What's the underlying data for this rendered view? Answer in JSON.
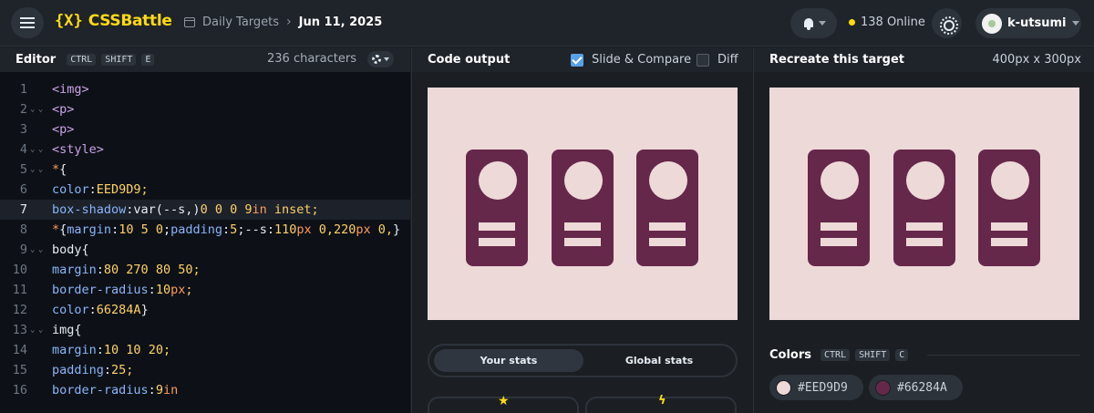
{
  "topbar": {
    "logo_mark": "{X}",
    "logo_text": "CSSBattle",
    "breadcrumb_link": "Daily Targets",
    "breadcrumb_current": "Jun 11, 2025",
    "online_count": "138 Online",
    "username": "k-utsumi"
  },
  "editor": {
    "title": "Editor",
    "shortcut": [
      "CTRL",
      "SHIFT",
      "E"
    ],
    "characters": "236 characters",
    "active_line": 7,
    "lines": [
      {
        "n": "1",
        "fold": "",
        "tokens": [
          [
            "t-tag",
            "<img>"
          ]
        ]
      },
      {
        "n": "2",
        "fold": "⌄ ⌄",
        "tokens": [
          [
            "t-tag",
            "<p>"
          ]
        ]
      },
      {
        "n": "3",
        "fold": "",
        "tokens": [
          [
            "t-tag",
            "<p>"
          ]
        ]
      },
      {
        "n": "4",
        "fold": "⌄ ⌄",
        "tokens": [
          [
            "t-tag",
            "<style>"
          ]
        ]
      },
      {
        "n": "5",
        "fold": "⌄ ⌄",
        "tokens": [
          [
            "t-sel",
            "*"
          ],
          [
            "t-plain",
            "{"
          ]
        ]
      },
      {
        "n": "6",
        "fold": "",
        "tokens": [
          [
            "t-prop",
            "color"
          ],
          [
            "t-plain",
            ":"
          ],
          [
            "t-val",
            "EED9D9;"
          ]
        ]
      },
      {
        "n": "7",
        "fold": "",
        "tokens": [
          [
            "t-prop",
            "box-shadow"
          ],
          [
            "t-plain",
            ":var(--s,)"
          ],
          [
            "t-val",
            "0 0 0 9"
          ],
          [
            "t-sel",
            "in"
          ],
          [
            "t-val",
            " inset;"
          ]
        ]
      },
      {
        "n": "8",
        "fold": "",
        "tokens": [
          [
            "t-sel",
            "*"
          ],
          [
            "t-plain",
            "{"
          ],
          [
            "t-prop",
            "margin"
          ],
          [
            "t-plain",
            ":"
          ],
          [
            "t-val",
            "10 5 0"
          ],
          [
            "t-plain",
            ";"
          ],
          [
            "t-prop",
            "padding"
          ],
          [
            "t-plain",
            ":"
          ],
          [
            "t-val",
            "5"
          ],
          [
            "t-plain",
            ";--s:"
          ],
          [
            "t-val",
            "110"
          ],
          [
            "t-sel",
            "px"
          ],
          [
            "t-val",
            " 0,220"
          ],
          [
            "t-sel",
            "px"
          ],
          [
            "t-val",
            " 0,"
          ],
          [
            "t-plain",
            "}"
          ]
        ]
      },
      {
        "n": "9",
        "fold": "⌄ ⌄",
        "tokens": [
          [
            "t-plain",
            "body{"
          ]
        ]
      },
      {
        "n": "10",
        "fold": "",
        "tokens": [
          [
            "t-prop",
            "margin"
          ],
          [
            "t-plain",
            ":"
          ],
          [
            "t-val",
            "80 270 80 50;"
          ]
        ]
      },
      {
        "n": "11",
        "fold": "",
        "tokens": [
          [
            "t-prop",
            "border-radius"
          ],
          [
            "t-plain",
            ":"
          ],
          [
            "t-val",
            "10"
          ],
          [
            "t-sel",
            "px"
          ],
          [
            "t-val",
            ";"
          ]
        ]
      },
      {
        "n": "12",
        "fold": "",
        "tokens": [
          [
            "t-prop",
            "color"
          ],
          [
            "t-plain",
            ":"
          ],
          [
            "t-val",
            "66284A"
          ],
          [
            "t-plain",
            "}"
          ]
        ]
      },
      {
        "n": "13",
        "fold": "⌄ ⌄",
        "tokens": [
          [
            "t-plain",
            "img{"
          ]
        ]
      },
      {
        "n": "14",
        "fold": "",
        "tokens": [
          [
            "t-prop",
            "margin"
          ],
          [
            "t-plain",
            ":"
          ],
          [
            "t-val",
            "10 10 20;"
          ]
        ]
      },
      {
        "n": "15",
        "fold": "",
        "tokens": [
          [
            "t-prop",
            "padding"
          ],
          [
            "t-plain",
            ":"
          ],
          [
            "t-val",
            "25;"
          ]
        ]
      },
      {
        "n": "16",
        "fold": "",
        "tokens": [
          [
            "t-prop",
            "border-radius"
          ],
          [
            "t-plain",
            ":"
          ],
          [
            "t-val",
            "9"
          ],
          [
            "t-sel",
            "in"
          ]
        ]
      }
    ]
  },
  "output": {
    "title": "Code output",
    "slide_compare_label": "Slide & Compare",
    "slide_compare_checked": true,
    "diff_label": "Diff",
    "diff_checked": false,
    "tab_your_stats": "Your stats",
    "tab_global_stats": "Global stats"
  },
  "target": {
    "title": "Recreate this target",
    "dimensions": "400px x 300px",
    "colors_title": "Colors",
    "colors_shortcut": [
      "CTRL",
      "SHIFT",
      "C"
    ],
    "swatches": [
      {
        "hex": "#EED9D9",
        "label": "#EED9D9"
      },
      {
        "hex": "#66284A",
        "label": "#66284A"
      }
    ]
  },
  "colors": {
    "background": "#EED9D9",
    "foreground": "#66284A",
    "accent": "#FFDB0F",
    "checkbox": "#5AA0E6"
  }
}
